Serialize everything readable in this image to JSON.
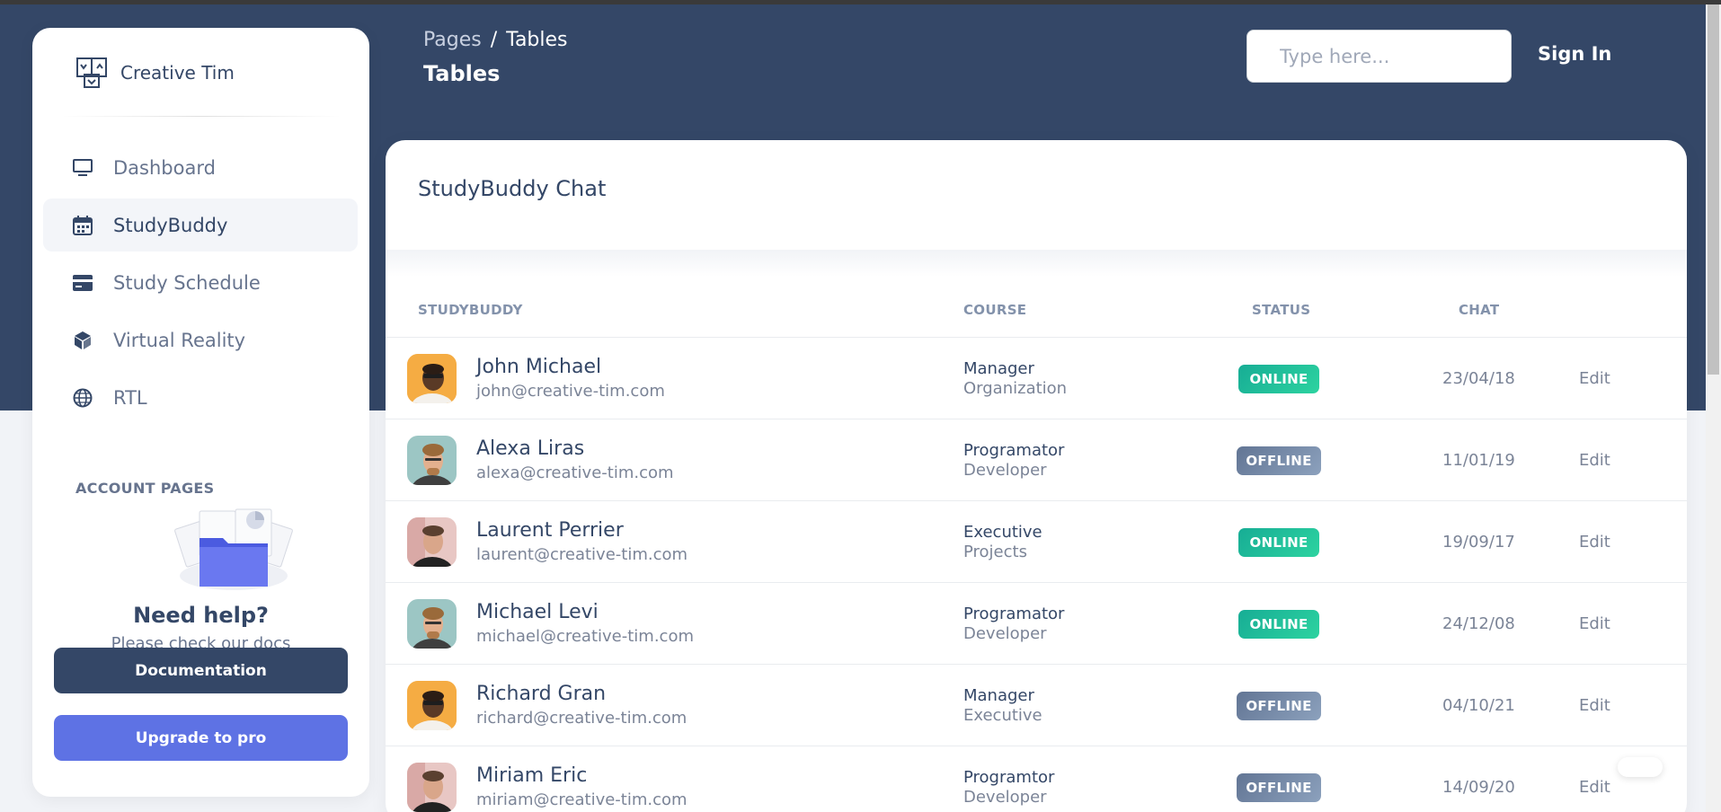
{
  "sidebar": {
    "brand": "Creative Tim",
    "items": [
      {
        "label": "Dashboard",
        "icon": "monitor-icon",
        "active": false
      },
      {
        "label": "StudyBuddy",
        "icon": "calendar-icon",
        "active": true
      },
      {
        "label": "Study Schedule",
        "icon": "credit-card-icon",
        "active": false
      },
      {
        "label": "Virtual Reality",
        "icon": "cube-icon",
        "active": false
      },
      {
        "label": "RTL",
        "icon": "globe-icon",
        "active": false
      }
    ],
    "section_title": "ACCOUNT PAGES",
    "help": {
      "title": "Need help?",
      "subtitle": "Please check our docs",
      "doc_button": "Documentation",
      "pro_button": "Upgrade to pro"
    }
  },
  "header": {
    "breadcrumb_root": "Pages",
    "breadcrumb_sep": "/",
    "breadcrumb_current": "Tables",
    "title": "Tables",
    "search_placeholder": "Type here...",
    "signin": "Sign In"
  },
  "card": {
    "title": "StudyBuddy Chat",
    "columns": [
      "STUDYBUDDY",
      "COURSE",
      "STATUS",
      "CHAT"
    ],
    "rows": [
      {
        "name": "John Michael",
        "email": "john@creative-tim.com",
        "role": "Manager",
        "dept": "Organization",
        "status": "ONLINE",
        "date": "23/04/18",
        "action": "Edit",
        "avatar": "orange"
      },
      {
        "name": "Alexa Liras",
        "email": "alexa@creative-tim.com",
        "role": "Programator",
        "dept": "Developer",
        "status": "OFFLINE",
        "date": "11/01/19",
        "action": "Edit",
        "avatar": "teal"
      },
      {
        "name": "Laurent Perrier",
        "email": "laurent@creative-tim.com",
        "role": "Executive",
        "dept": "Projects",
        "status": "ONLINE",
        "date": "19/09/17",
        "action": "Edit",
        "avatar": "pink"
      },
      {
        "name": "Michael Levi",
        "email": "michael@creative-tim.com",
        "role": "Programator",
        "dept": "Developer",
        "status": "ONLINE",
        "date": "24/12/08",
        "action": "Edit",
        "avatar": "teal"
      },
      {
        "name": "Richard Gran",
        "email": "richard@creative-tim.com",
        "role": "Manager",
        "dept": "Executive",
        "status": "OFFLINE",
        "date": "04/10/21",
        "action": "Edit",
        "avatar": "orange"
      },
      {
        "name": "Miriam Eric",
        "email": "miriam@creative-tim.com",
        "role": "Programtor",
        "dept": "Developer",
        "status": "OFFLINE",
        "date": "14/09/20",
        "action": "Edit",
        "avatar": "pink"
      }
    ]
  },
  "colors": {
    "hero": "#344767",
    "online": "#2dce89",
    "offline": "#8392ab",
    "primary": "#5e72e4"
  }
}
